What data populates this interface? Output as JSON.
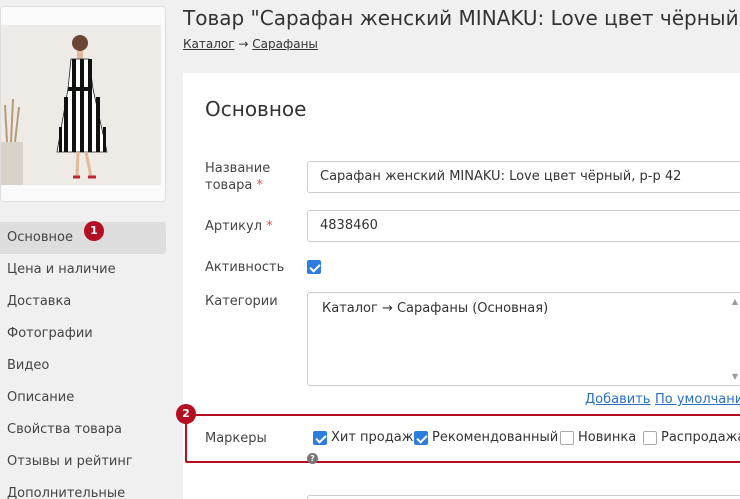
{
  "page": {
    "title": "Товар \"Сарафан женский MINAKU: Love цвет чёрный, р",
    "breadcrumb": {
      "catalog": "Каталог",
      "arrow": "→",
      "category": "Сарафаны"
    }
  },
  "sidebar": {
    "items": [
      {
        "label": "Основное",
        "active": true
      },
      {
        "label": "Цена и наличие"
      },
      {
        "label": "Доставка"
      },
      {
        "label": "Фотографии"
      },
      {
        "label": "Видео"
      },
      {
        "label": "Описание"
      },
      {
        "label": "Свойства товара"
      },
      {
        "label": "Отзывы и рейтинг"
      },
      {
        "label": "Дополнительные"
      }
    ]
  },
  "annotations": {
    "badge1": "1",
    "badge2": "2"
  },
  "main": {
    "section_title": "Основное",
    "name_label_line1": "Название",
    "name_label_line2": "товара",
    "required_mark": "*",
    "name_value": "Сарафан женский MINAKU: Love цвет чёрный, р-р 42",
    "sku_label": "Артикул",
    "sku_value": "4838460",
    "active_label": "Активность",
    "active_checked": true,
    "categories_label": "Категории",
    "categories_value": "Каталог → Сарафаны (Основная)",
    "add_link": "Добавить",
    "default_link": "По умолчани",
    "markers_label": "Маркеры",
    "markers": [
      {
        "label": "Хит продаж",
        "checked": true
      },
      {
        "label": "Рекомендованный",
        "checked": true
      },
      {
        "label": "Новинка",
        "checked": false
      },
      {
        "label": "Распродажа",
        "checked": false
      }
    ],
    "help_glyph": "?"
  },
  "colors": {
    "accent": "#2d7de0",
    "annotation": "#b50e22",
    "link": "#2a6fc9",
    "required": "#d9534f"
  }
}
